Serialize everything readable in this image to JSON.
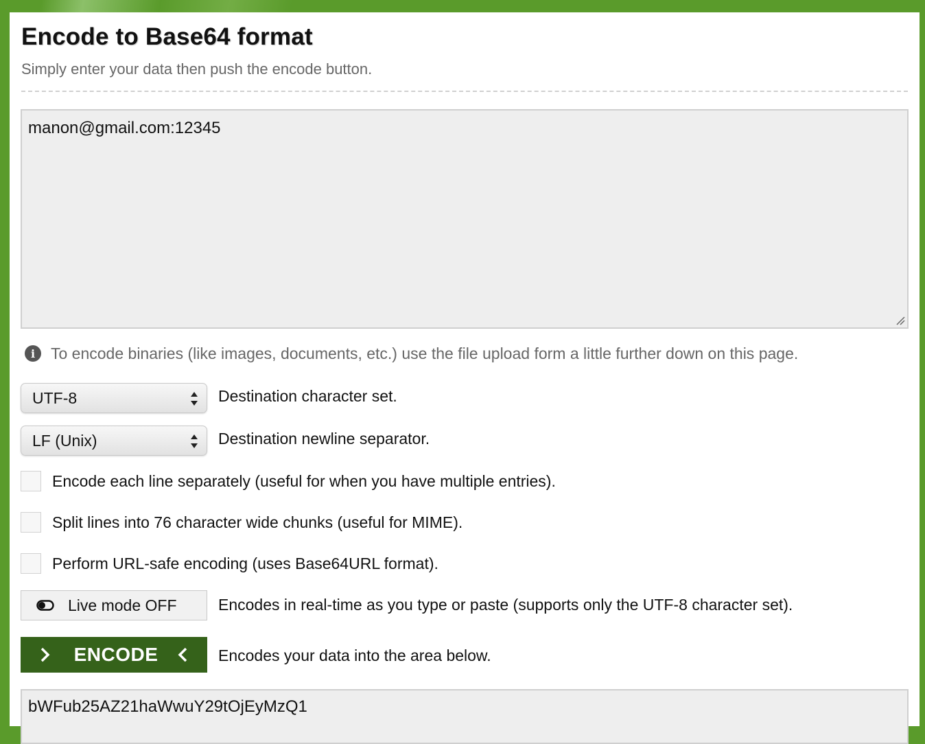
{
  "header": {
    "title": "Encode to Base64 format",
    "subtitle": "Simply enter your data then push the encode button."
  },
  "input": {
    "value": "manon@gmail.com:12345"
  },
  "info": {
    "icon": "info-icon",
    "text": "To encode binaries (like images, documents, etc.) use the file upload form a little further down on this page."
  },
  "charset": {
    "selected": "UTF-8",
    "label": "Destination character set."
  },
  "newline": {
    "selected": "LF (Unix)",
    "label": "Destination newline separator."
  },
  "options": {
    "each_line": {
      "checked": false,
      "label": "Encode each line separately (useful for when you have multiple entries)."
    },
    "split_lines": {
      "checked": false,
      "label": "Split lines into 76 character wide chunks (useful for MIME)."
    },
    "url_safe": {
      "checked": false,
      "label": "Perform URL-safe encoding (uses Base64URL format)."
    }
  },
  "live_mode": {
    "button_label": "Live mode OFF",
    "description": "Encodes in real-time as you type or paste (supports only the UTF-8 character set)."
  },
  "encode": {
    "button_label": "ENCODE",
    "description": "Encodes your data into the area below."
  },
  "output": {
    "value": "bWFub25AZ21haWwuY29tOjEyMzQ1"
  },
  "colors": {
    "background_green": "#5a9b2b",
    "encode_button": "#35621a",
    "textarea_bg": "#eeeeee"
  }
}
